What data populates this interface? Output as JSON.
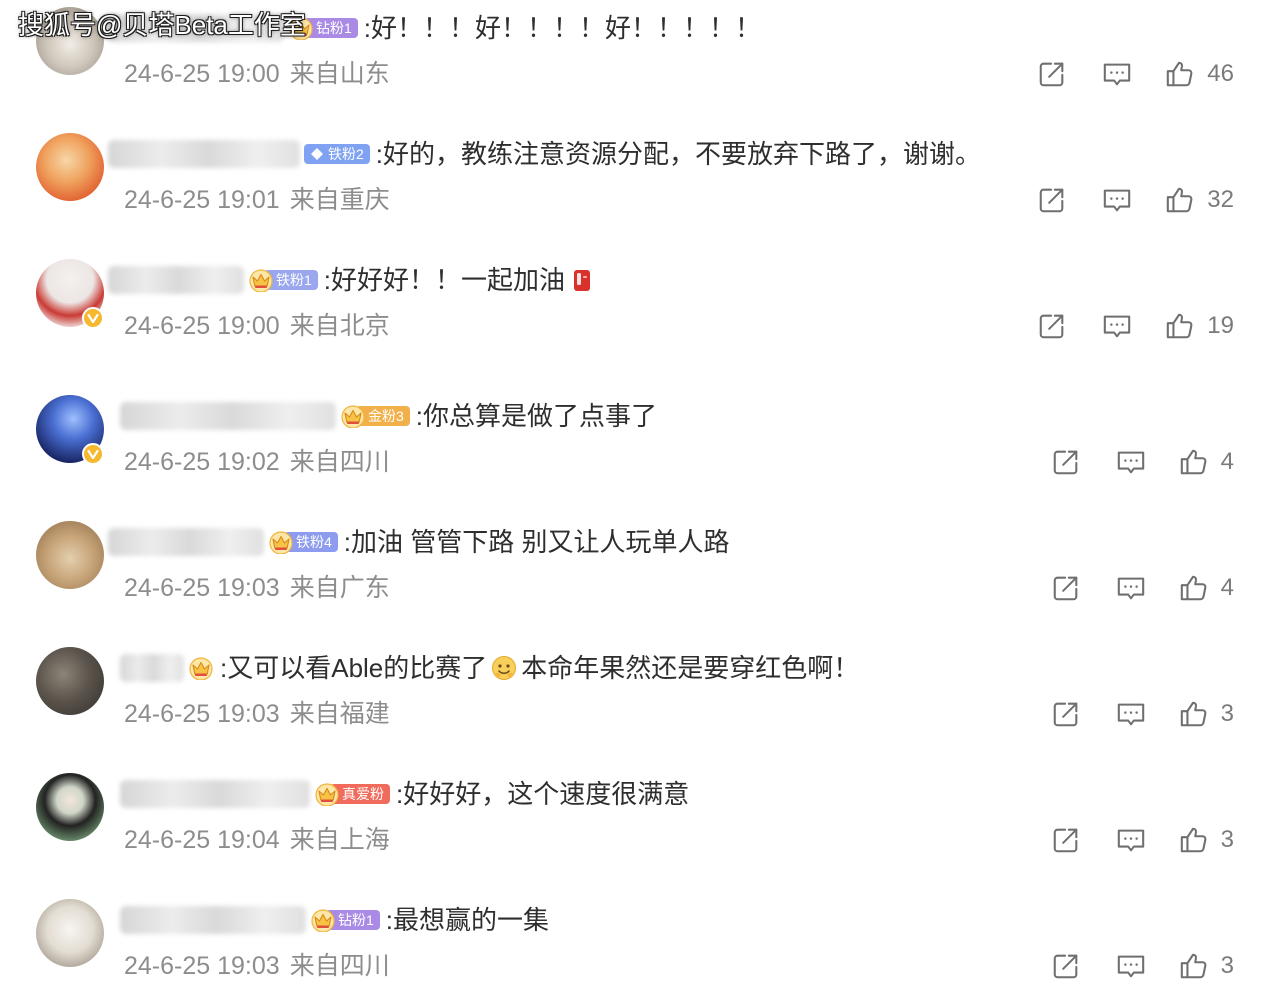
{
  "watermark": "搜狐号@贝塔Beta工作室",
  "colors": {
    "text": "#2e2e2e",
    "meta": "#8d8d8d",
    "icon": "#6f6f6f",
    "verified": "#f5b82e",
    "crown": "#f6c344"
  },
  "comments": [
    {
      "badge": "钻粉1",
      "badge_icon": "crown-icon",
      "badge_color": "#a98be6",
      "text": ":好！！！好！！！！好！！！！！",
      "time": "24-6-25 19:00",
      "location": "来自山东",
      "likes": "46",
      "verified": false
    },
    {
      "badge": "铁粉2",
      "badge_icon": "diamond-icon",
      "badge_color": "#7fa3f2",
      "text": ":好的，教练注意资源分配，不要放弃下路了，谢谢。",
      "time": "24-6-25 19:01",
      "location": "来自重庆",
      "likes": "32",
      "verified": false
    },
    {
      "badge": "铁粉1",
      "badge_icon": "crown-icon",
      "badge_color": "#9aa7ee",
      "text": ":好好好！！一起加油",
      "emoji": "red-cheer-emoji-icon",
      "time": "24-6-25 19:00",
      "location": "来自北京",
      "likes": "19",
      "verified": true
    },
    {
      "badge": "金粉3",
      "badge_icon": "crown-icon",
      "badge_color": "#f2b04a",
      "text": ":你总算是做了点事了",
      "time": "24-6-25 19:02",
      "location": "来自四川",
      "likes": "4",
      "verified": true
    },
    {
      "badge": "铁粉4",
      "badge_icon": "crown-icon",
      "badge_color": "#8e9cf0",
      "text": ":加油 管管下路 别又让人玩单人路",
      "time": "24-6-25 19:03",
      "location": "来自广东",
      "likes": "4",
      "verified": false
    },
    {
      "badge_icon": "crown-icon",
      "text": ":又可以看Able的比赛了",
      "emoji": "yellow-face-emoji-icon",
      "text_after": "本命年果然还是要穿红色啊！",
      "time": "24-6-25 19:03",
      "location": "来自福建",
      "likes": "3",
      "verified": false
    },
    {
      "badge": "真爱粉",
      "badge_icon": "crown-icon",
      "badge_color": "#f06b5b",
      "text": ":好好好，这个速度很满意",
      "time": "24-6-25 19:04",
      "location": "来自上海",
      "likes": "3",
      "verified": false
    },
    {
      "badge": "钻粉1",
      "badge_icon": "crown-icon",
      "badge_color": "#a98be6",
      "text": ":最想赢的一集",
      "time": "24-6-25 19:03",
      "location": "来自四川",
      "likes": "3",
      "verified": false
    }
  ]
}
